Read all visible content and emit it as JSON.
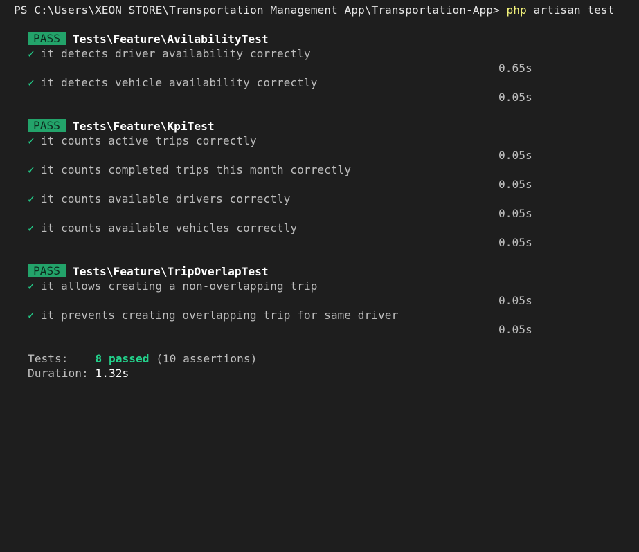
{
  "prompt": {
    "path": "PS C:\\Users\\XEON STORE\\Transportation Management App\\Transportation-App>",
    "command": "php",
    "args": "artisan test"
  },
  "pass_label": "PASS",
  "check_glyph": "✓",
  "suites": [
    {
      "name": "Tests\\Feature\\AvilabilityTest",
      "tests": [
        {
          "desc": "it detects driver availability correctly",
          "duration": "0.65s"
        },
        {
          "desc": "it detects vehicle availability correctly",
          "duration": "0.05s"
        }
      ]
    },
    {
      "name": "Tests\\Feature\\KpiTest",
      "tests": [
        {
          "desc": "it counts active trips correctly",
          "duration": "0.05s"
        },
        {
          "desc": "it counts completed trips this month correctly",
          "duration": "0.05s"
        },
        {
          "desc": "it counts available drivers correctly",
          "duration": "0.05s"
        },
        {
          "desc": "it counts available vehicles correctly",
          "duration": "0.05s"
        }
      ]
    },
    {
      "name": "Tests\\Feature\\TripOverlapTest",
      "tests": [
        {
          "desc": "it allows creating a non-overlapping trip",
          "duration": "0.05s"
        },
        {
          "desc": "it prevents creating overlapping trip for same driver",
          "duration": "0.05s"
        }
      ]
    }
  ],
  "summary": {
    "tests_label": "Tests:",
    "passed": "8 passed",
    "assertions": "(10 assertions)",
    "duration_label": "Duration:",
    "duration": "1.32s"
  },
  "colors": {
    "background": "#1e1e1e",
    "pass_badge": "#23a36a",
    "check": "#23d18b",
    "command": "#f1f17a"
  }
}
